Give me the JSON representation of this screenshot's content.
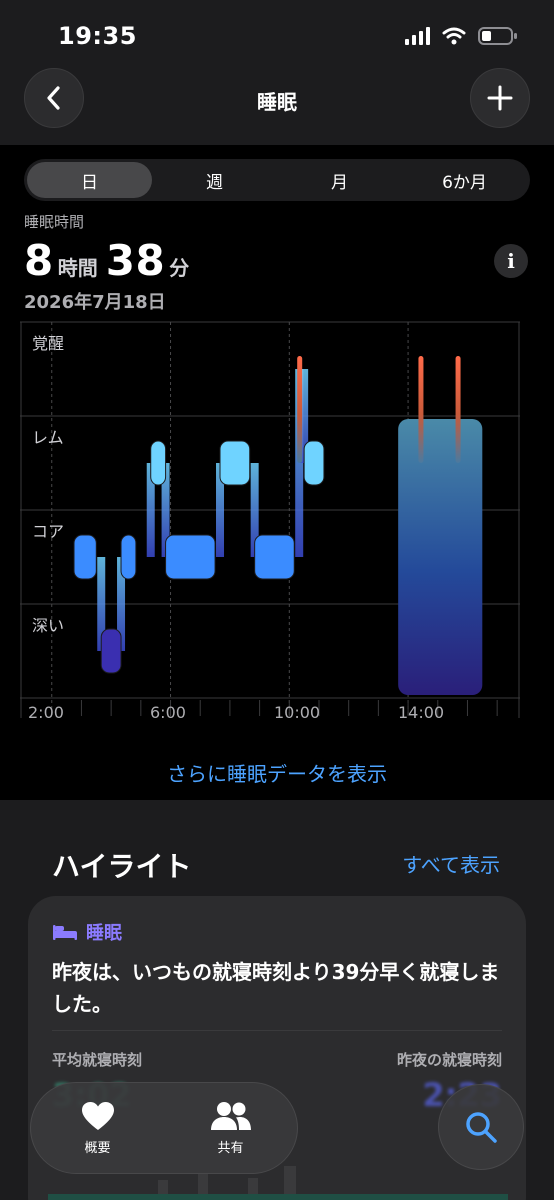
{
  "status": {
    "time": "19:35"
  },
  "nav": {
    "title": "睡眠",
    "back_icon": "chevron-left-icon",
    "add_icon": "plus-icon"
  },
  "segments": {
    "items": [
      "日",
      "週",
      "月",
      "6か月"
    ],
    "selected": "日"
  },
  "summary": {
    "label": "睡眠時間",
    "hours": "8",
    "hours_unit": "時間",
    "minutes": "38",
    "minutes_unit": "分",
    "date": "2026年7月18日"
  },
  "chart_data": {
    "type": "area",
    "stages": [
      "覚醒",
      "レム",
      "コア",
      "深い"
    ],
    "x_ticks": [
      "2:00",
      "6:00",
      "10:00",
      "14:00"
    ],
    "segments": [
      {
        "stage": "コア",
        "start": "2:45",
        "end": "3:30"
      },
      {
        "stage": "深い",
        "start": "3:40",
        "end": "4:20"
      },
      {
        "stage": "コア",
        "start": "4:20",
        "end": "4:50"
      },
      {
        "stage": "レム",
        "start": "5:20",
        "end": "5:50"
      },
      {
        "stage": "コア",
        "start": "5:50",
        "end": "7:30"
      },
      {
        "stage": "レム",
        "start": "7:40",
        "end": "8:40"
      },
      {
        "stage": "コア",
        "start": "8:50",
        "end": "10:10"
      },
      {
        "stage": "覚醒",
        "start": "10:20",
        "end": "10:30"
      },
      {
        "stage": "レム",
        "start": "10:30",
        "end": "11:10"
      },
      {
        "stage": "深い",
        "start": "13:40",
        "end": "16:30"
      },
      {
        "stage": "覚醒",
        "start": "14:25",
        "end": "14:35"
      },
      {
        "stage": "覚醒",
        "start": "15:40",
        "end": "15:50"
      }
    ],
    "colors": {
      "awake": "#ff6b4a",
      "rem": "#6fd3ff",
      "core": "#3b8cff",
      "deep": "#3a2fb0"
    }
  },
  "more_link": "さらに睡眠データを表示",
  "highlights": {
    "title": "ハイライト",
    "see_all": "すべて表示",
    "card": {
      "tag": "睡眠",
      "text": "昨夜は、いつもの就寝時刻より39分早く就寝しました。",
      "avg_label": "平均就寝時刻",
      "last_label": "昨夜の就寝時刻",
      "avg_value": "3:02",
      "last_value": "2:23"
    }
  },
  "tabbar": {
    "items": [
      {
        "label": "概要",
        "icon": "heart-icon"
      },
      {
        "label": "共有",
        "icon": "people-icon"
      }
    ],
    "search_icon": "search-icon"
  }
}
